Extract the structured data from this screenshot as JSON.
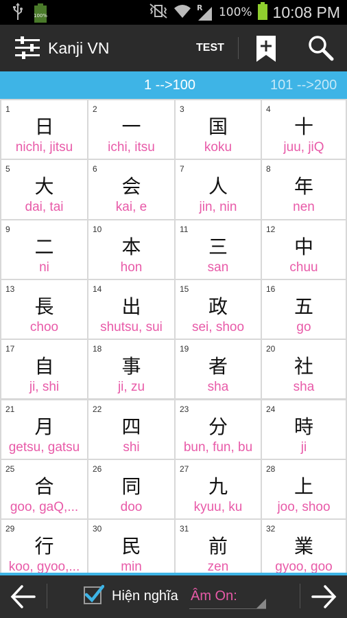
{
  "status_bar": {
    "battery_small_label": "100%",
    "data_indicator": "R",
    "battery_percent": "100%",
    "time": "10:08 PM"
  },
  "action_bar": {
    "title": "Kanji VN",
    "test_label": "TEST"
  },
  "ranges": [
    {
      "label": "1 -->100",
      "active": true
    },
    {
      "label": "101 -->200",
      "active": false
    }
  ],
  "colors": {
    "accent": "#3eb4e6",
    "reading": "#e85aa8",
    "action_bar": "#2b2b2b"
  },
  "kanji": [
    {
      "num": "1",
      "kanji": "日",
      "reading": "nichi, jitsu"
    },
    {
      "num": "2",
      "kanji": "一",
      "reading": "ichi, itsu"
    },
    {
      "num": "3",
      "kanji": "国",
      "reading": "koku"
    },
    {
      "num": "4",
      "kanji": "十",
      "reading": "juu, jiQ"
    },
    {
      "num": "5",
      "kanji": "大",
      "reading": "dai, tai"
    },
    {
      "num": "6",
      "kanji": "会",
      "reading": "kai, e"
    },
    {
      "num": "7",
      "kanji": "人",
      "reading": "jin, nin"
    },
    {
      "num": "8",
      "kanji": "年",
      "reading": "nen"
    },
    {
      "num": "9",
      "kanji": "二",
      "reading": "ni"
    },
    {
      "num": "10",
      "kanji": "本",
      "reading": "hon"
    },
    {
      "num": "11",
      "kanji": "三",
      "reading": "san"
    },
    {
      "num": "12",
      "kanji": "中",
      "reading": "chuu"
    },
    {
      "num": "13",
      "kanji": "長",
      "reading": "choo"
    },
    {
      "num": "14",
      "kanji": "出",
      "reading": "shutsu, sui"
    },
    {
      "num": "15",
      "kanji": "政",
      "reading": "sei, shoo"
    },
    {
      "num": "16",
      "kanji": "五",
      "reading": "go"
    },
    {
      "num": "17",
      "kanji": "自",
      "reading": "ji, shi"
    },
    {
      "num": "18",
      "kanji": "事",
      "reading": "ji, zu"
    },
    {
      "num": "19",
      "kanji": "者",
      "reading": "sha"
    },
    {
      "num": "20",
      "kanji": "社",
      "reading": "sha"
    },
    {
      "num": "21",
      "kanji": "月",
      "reading": "getsu, gatsu"
    },
    {
      "num": "22",
      "kanji": "四",
      "reading": "shi"
    },
    {
      "num": "23",
      "kanji": "分",
      "reading": "bun, fun, bu"
    },
    {
      "num": "24",
      "kanji": "時",
      "reading": "ji"
    },
    {
      "num": "25",
      "kanji": "合",
      "reading": "goo, gaQ,..."
    },
    {
      "num": "26",
      "kanji": "同",
      "reading": "doo"
    },
    {
      "num": "27",
      "kanji": "九",
      "reading": "kyuu, ku"
    },
    {
      "num": "28",
      "kanji": "上",
      "reading": "joo, shoo"
    },
    {
      "num": "29",
      "kanji": "行",
      "reading": "koo, gyoo,..."
    },
    {
      "num": "30",
      "kanji": "民",
      "reading": "min"
    },
    {
      "num": "31",
      "kanji": "前",
      "reading": "zen"
    },
    {
      "num": "32",
      "kanji": "業",
      "reading": "gyoo, goo"
    }
  ],
  "bottom_bar": {
    "show_meaning_label": "Hiện nghĩa",
    "show_meaning_checked": true,
    "reading_mode_selected": "Âm On:"
  }
}
